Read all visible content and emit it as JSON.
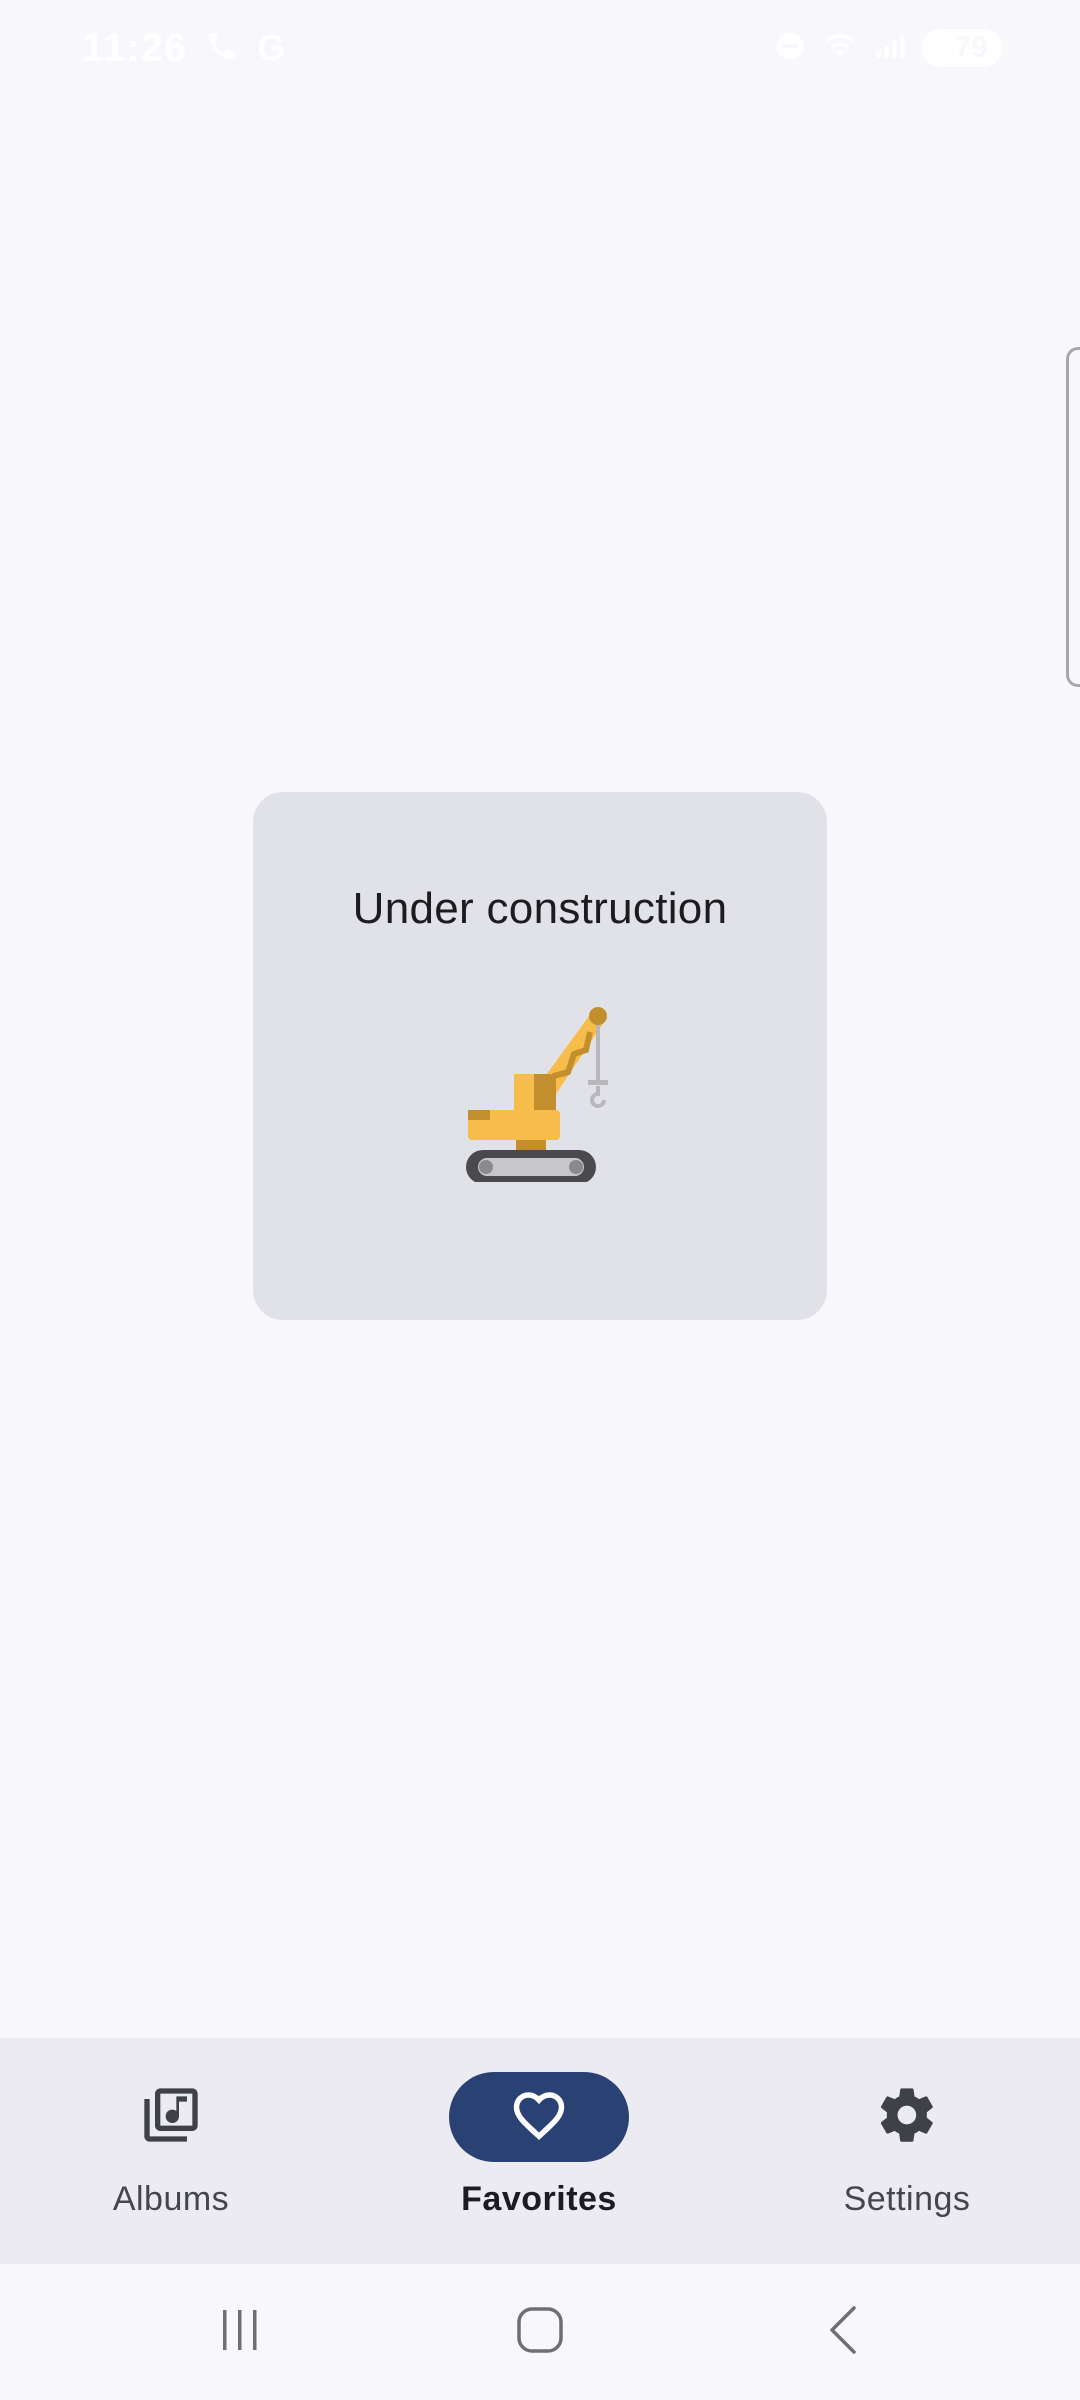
{
  "status_bar": {
    "time": "11:26",
    "left_icons": [
      "call-icon",
      "google-icon"
    ],
    "right_icons": [
      "dnd-icon",
      "wifi-icon",
      "signal-icon"
    ],
    "battery_level": "79"
  },
  "card": {
    "title": "Under construction",
    "illustration": "crane-icon",
    "background_color": "#e1e2e7"
  },
  "bottom_nav": {
    "items": [
      {
        "label": "Albums",
        "icon": "album-library-icon",
        "selected": false
      },
      {
        "label": "Favorites",
        "icon": "heart-icon",
        "selected": true
      },
      {
        "label": "Settings",
        "icon": "gear-icon",
        "selected": false
      }
    ],
    "active_color": "#2a4173"
  },
  "system_nav": {
    "buttons": [
      "recent-apps",
      "home",
      "back"
    ]
  }
}
